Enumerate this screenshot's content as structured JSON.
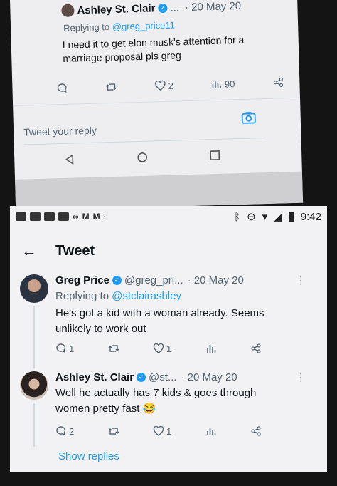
{
  "upper": {
    "author_name": "Ashley St. Clair",
    "author_handle_trunc": "...",
    "date": "· 20 May 20",
    "replying_prefix": "Replying to",
    "replying_handle": "@greg_price11",
    "text": "I need it to get elon musk's attention for a marriage proposal pls greg",
    "actions": {
      "like_count": "2",
      "views_count": "90"
    },
    "reply_placeholder": "Tweet your reply"
  },
  "status_bar": {
    "time": "9:42"
  },
  "header": {
    "title": "Tweet"
  },
  "tweets": [
    {
      "name": "Greg Price",
      "handle": "@greg_pri...",
      "date": "· 20 May 20",
      "replying_prefix": "Replying to",
      "replying_handle": "@stclairashley",
      "text": "He's got a kid with a woman already. Seems unlikely to work out",
      "reply_count": "1",
      "like_count": "1"
    },
    {
      "name": "Ashley St. Clair",
      "handle": "@st...",
      "date": "· 20 May 20",
      "text": "Well he actually has 7 kids & goes through women pretty fast 😂",
      "reply_count": "2",
      "like_count": "1"
    }
  ],
  "show_replies": "Show replies",
  "colors": {
    "accent": "#1d9bf0",
    "muted": "#536471",
    "text": "#0f1419"
  }
}
